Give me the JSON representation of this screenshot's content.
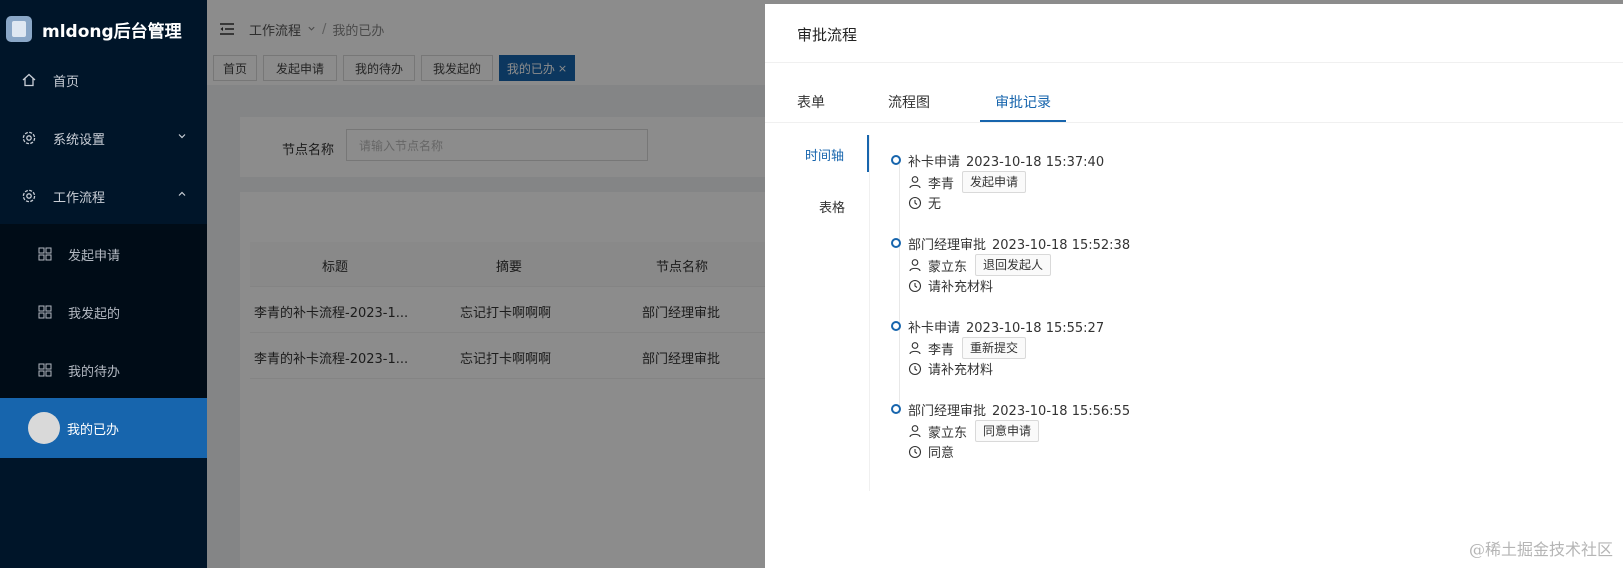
{
  "sidebar": {
    "logo_text": "mldong后台管理",
    "items": [
      {
        "label": "首页"
      },
      {
        "label": "系统设置"
      },
      {
        "label": "工作流程"
      }
    ],
    "sub_items": [
      {
        "label": "发起申请"
      },
      {
        "label": "我发起的"
      },
      {
        "label": "我的待办"
      },
      {
        "label": "我的已办"
      }
    ]
  },
  "header": {
    "breadcrumb": [
      "工作流程",
      "我的已办"
    ],
    "separator": "/"
  },
  "tabs": [
    {
      "label": "首页"
    },
    {
      "label": "发起申请"
    },
    {
      "label": "我的待办"
    },
    {
      "label": "我发起的"
    },
    {
      "label": "我的已办",
      "close": "×"
    }
  ],
  "search": {
    "label": "节点名称",
    "placeholder": "请输入节点名称"
  },
  "table": {
    "columns": [
      "标题",
      "摘要",
      "节点名称"
    ],
    "rows": [
      [
        "李青的补卡流程-2023-1...",
        "忘记打卡啊啊啊",
        "部门经理审批"
      ],
      [
        "李青的补卡流程-2023-1...",
        "忘记打卡啊啊啊",
        "部门经理审批"
      ]
    ]
  },
  "drawer": {
    "title": "审批流程",
    "tabs": [
      "表单",
      "流程图",
      "审批记录"
    ],
    "active_tab": "审批记录",
    "side_tabs": [
      "时间轴",
      "表格"
    ],
    "active_side_tab": "时间轴",
    "timeline": [
      {
        "node": "补卡申请",
        "time": "2023-10-18 15:37:40",
        "user": "李青",
        "action": "发起申请",
        "comment": "无"
      },
      {
        "node": "部门经理审批",
        "time": "2023-10-18 15:52:38",
        "user": "蒙立东",
        "action": "退回发起人",
        "comment": "请补充材料"
      },
      {
        "node": "补卡申请",
        "time": "2023-10-18 15:55:27",
        "user": "李青",
        "action": "重新提交",
        "comment": "请补充材料"
      },
      {
        "node": "部门经理审批",
        "time": "2023-10-18 15:56:55",
        "user": "蒙立东",
        "action": "同意申请",
        "comment": "同意"
      }
    ]
  },
  "watermark": "@稀土掘金技术社区",
  "colors": {
    "accent": "#1765ad",
    "sidebar_bg": "#001529"
  }
}
